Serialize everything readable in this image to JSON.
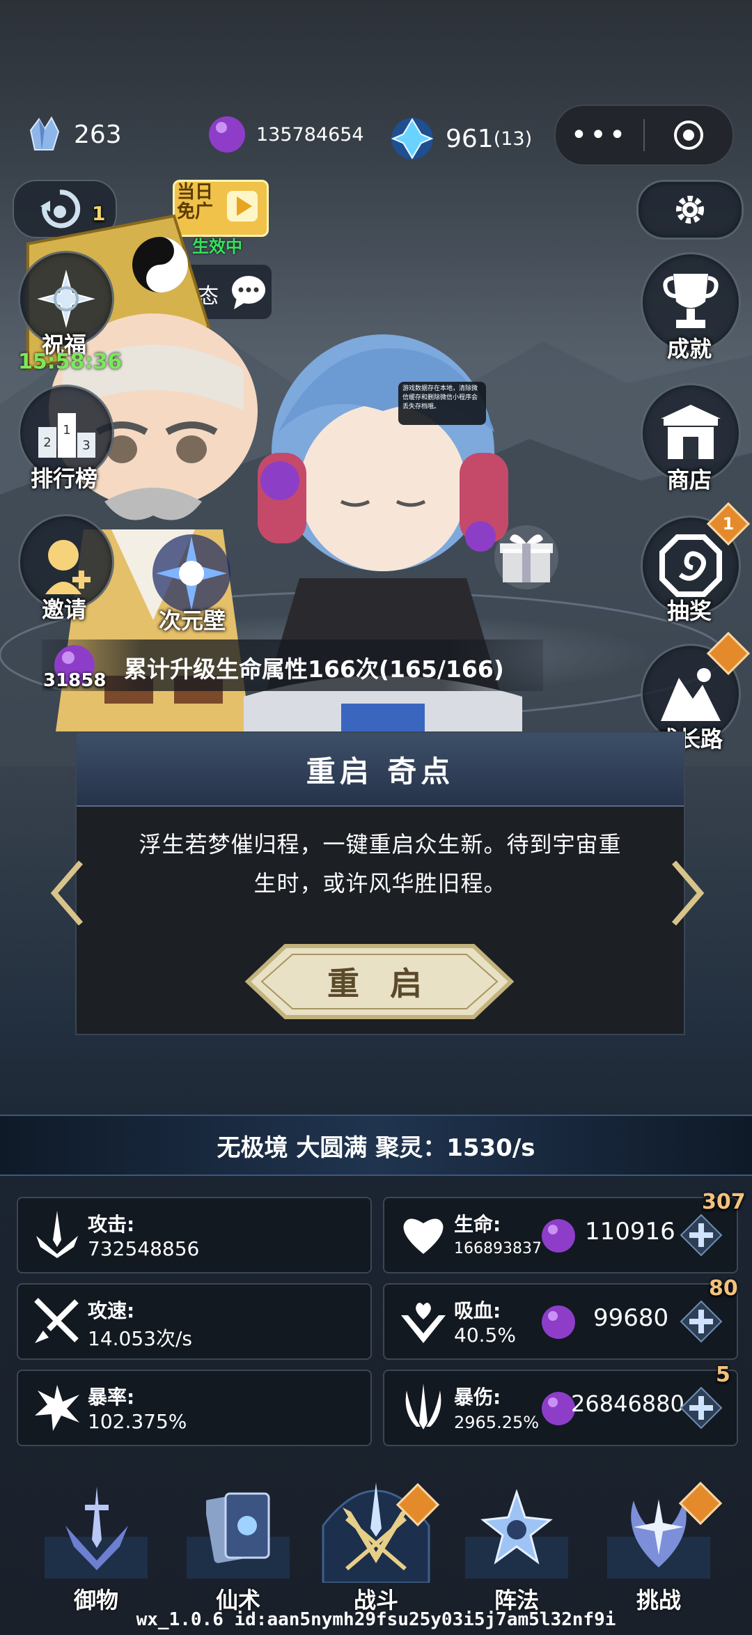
{
  "resources": {
    "crystal_count": "263",
    "orb_count": "135784654",
    "gem_count": "961",
    "gem_extra": "(13)"
  },
  "capsule": {
    "more_icon": "more-icon",
    "close_icon": "target-icon"
  },
  "left_menu": {
    "refresh_count": "1",
    "free_ad_line1": "当日",
    "free_ad_line2": "免广",
    "free_ad_status": "生效中",
    "dynamic_label": "动态",
    "blessing_label": "祝福",
    "blessing_timer": "15:58:36",
    "ranking_label": "排行榜",
    "invite_label": "邀请",
    "dimension_label": "次元壁",
    "orb_small_count": "31858"
  },
  "right_menu": {
    "achievement_label": "成就",
    "shop_label": "商店",
    "lottery_label": "抽奖",
    "lottery_badge": "1",
    "growth_label": "成长路"
  },
  "notice_text": "游戏数据存在本地，清除微信缓存和删除微信小程序会丢失存档哦。",
  "progress_banner": "累计升级生命属性166次(165/166)",
  "panel": {
    "title": "重启 奇点",
    "desc_line1": "浮生若梦催归程，一键重启众生新。待到宇宙重",
    "desc_line2": "生时，或许风华胜旧程。",
    "button_label": "重 启"
  },
  "realm_text": "无极境 大圆满 聚灵：1530/s",
  "stats": {
    "attack_label": "攻击:",
    "attack_value": "732548856",
    "speed_label": "攻速:",
    "speed_value": "14.053次/s",
    "crit_label": "暴率:",
    "crit_value": "102.375%",
    "hp_label": "生命:",
    "hp_value": "166893837",
    "hp_cost": "110916",
    "hp_badge": "307",
    "lifesteal_label": "吸血:",
    "lifesteal_value": "40.5%",
    "lifesteal_cost": "99680",
    "lifesteal_badge": "80",
    "critdmg_label": "暴伤:",
    "critdmg_value": "2965.25%",
    "critdmg_cost": "26846880",
    "critdmg_badge": "5"
  },
  "nav": {
    "items": [
      {
        "label": "御物"
      },
      {
        "label": "仙术"
      },
      {
        "label": "战斗"
      },
      {
        "label": "阵法"
      },
      {
        "label": "挑战"
      }
    ]
  },
  "footer_id": "wx_1.0.6 id:aan5nymh29fsu25y03i5j7am5l32nf9i"
}
